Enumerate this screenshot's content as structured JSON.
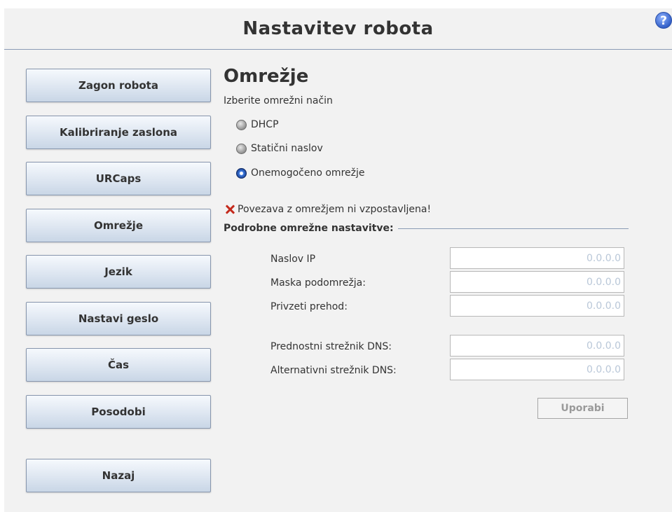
{
  "header": {
    "title": "Nastavitev robota",
    "help_label": "?"
  },
  "sidebar": {
    "items": [
      {
        "label": "Zagon robota"
      },
      {
        "label": "Kalibriranje zaslona"
      },
      {
        "label": "URCaps"
      },
      {
        "label": "Omrežje"
      },
      {
        "label": "Jezik"
      },
      {
        "label": "Nastavi geslo"
      },
      {
        "label": "Čas"
      },
      {
        "label": "Posodobi"
      }
    ],
    "back_label": "Nazaj"
  },
  "network": {
    "title": "Omrežje",
    "subtitle": "Izberite omrežni način",
    "modes": [
      {
        "label": "DHCP",
        "selected": false
      },
      {
        "label": "Statični naslov",
        "selected": false
      },
      {
        "label": "Onemogočeno omrežje",
        "selected": true
      }
    ],
    "status_text": "Povezava z omrežjem ni vzpostavljena!",
    "details_heading": "Podrobne omrežne nastavitve:",
    "fields": [
      {
        "label": "Naslov IP",
        "value": "0.0.0.0"
      },
      {
        "label": "Maska podomrežja:",
        "value": "0.0.0.0"
      },
      {
        "label": "Privzeti prehod:",
        "value": "0.0.0.0"
      },
      {
        "label": "Prednostni strežnik DNS:",
        "value": "0.0.0.0"
      },
      {
        "label": "Alternativni strežnik DNS:",
        "value": "0.0.0.0"
      }
    ],
    "apply_label": "Uporabi"
  },
  "colors": {
    "accent": "#8a9bb5",
    "error": "#c42a1c",
    "selected_radio": "#3a78e0",
    "placeholder_value": "#b9c7d8"
  },
  "icons": [
    "help-icon",
    "error-x-icon",
    "radio-icon"
  ]
}
